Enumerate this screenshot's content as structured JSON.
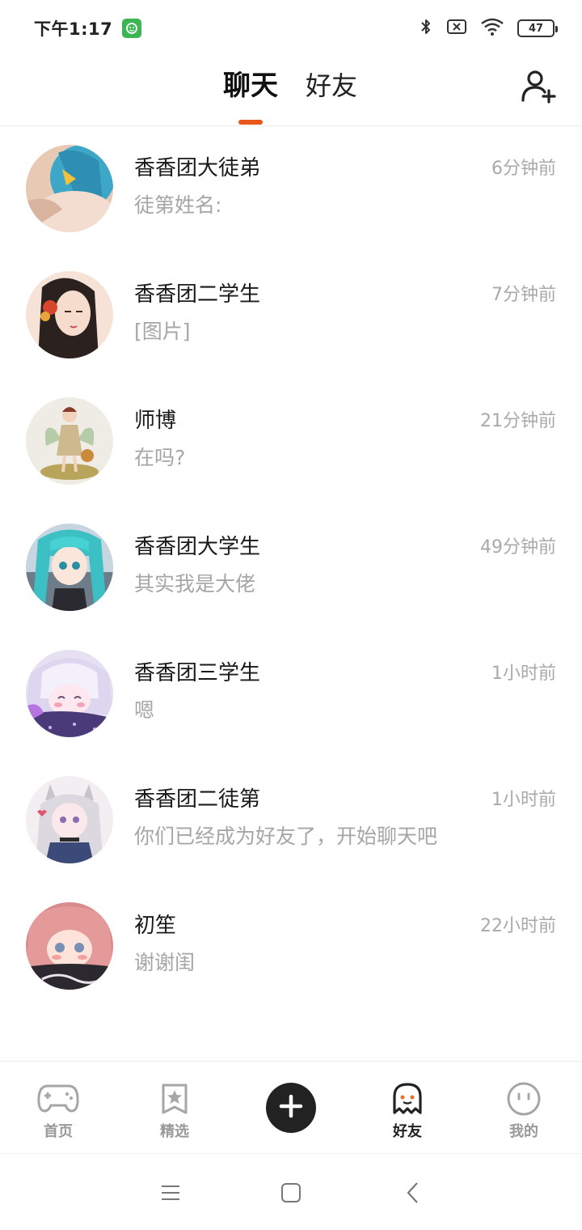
{
  "status_bar": {
    "time": "下午1:17",
    "battery": "47",
    "icons": [
      "app-notification-icon",
      "bluetooth-icon",
      "sim-off-icon",
      "wifi-icon",
      "battery-icon"
    ]
  },
  "header": {
    "tabs": [
      {
        "label": "聊天",
        "active": true
      },
      {
        "label": "好友",
        "active": false
      }
    ],
    "accent_color": "#e8561a",
    "add_friend_icon": "add-user-icon"
  },
  "conversations": [
    {
      "name": "香香团大徒弟",
      "preview": "徒第姓名:",
      "time": "6分钟前"
    },
    {
      "name": "香香团二学生",
      "preview": "[图片]",
      "time": "7分钟前"
    },
    {
      "name": "师博",
      "preview": "在吗?",
      "time": "21分钟前"
    },
    {
      "name": "香香团大学生",
      "preview": "其实我是大佬",
      "time": "49分钟前"
    },
    {
      "name": "香香团三学生",
      "preview": "嗯",
      "time": "1小时前"
    },
    {
      "name": "香香团二徒第",
      "preview": "你们已经成为好友了，开始聊天吧",
      "time": "1小时前"
    },
    {
      "name": "初笙",
      "preview": "谢谢闺",
      "time": "22小时前"
    }
  ],
  "bottom_nav": {
    "items": [
      {
        "label": "首页",
        "icon": "gamepad-icon",
        "active": false
      },
      {
        "label": "精选",
        "icon": "star-bookmark-icon",
        "active": false
      },
      {
        "label": "",
        "icon": "plus-icon",
        "active": false
      },
      {
        "label": "好友",
        "icon": "ghost-icon",
        "active": true
      },
      {
        "label": "我的",
        "icon": "face-icon",
        "active": false
      }
    ]
  },
  "system_nav": {
    "icons": [
      "menu-icon",
      "home-icon",
      "back-icon"
    ]
  }
}
